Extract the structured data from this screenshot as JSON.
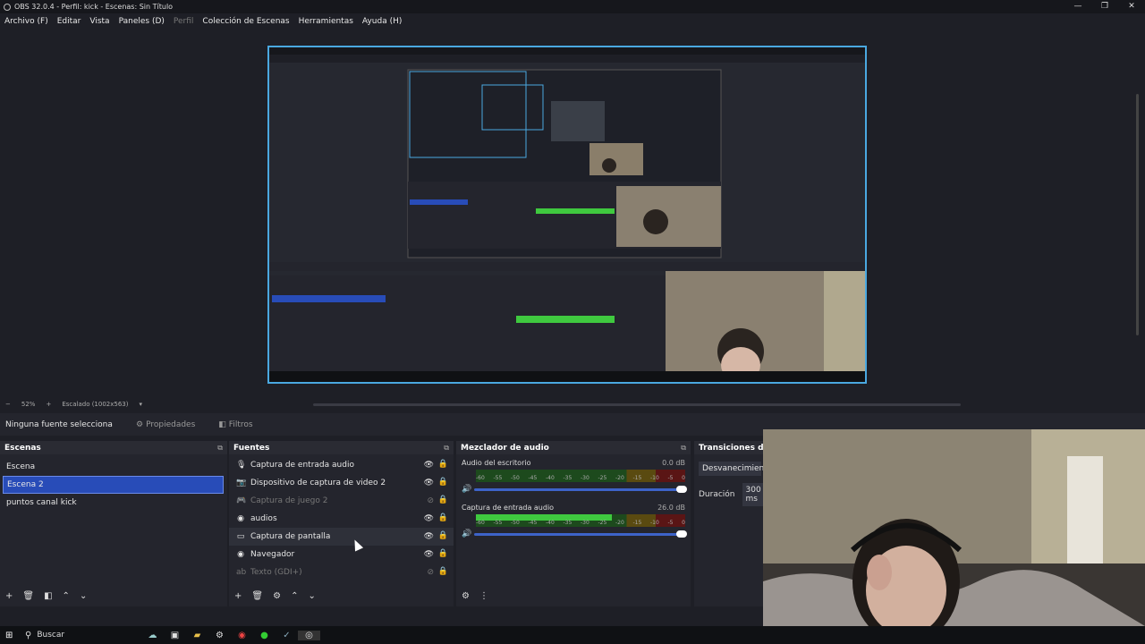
{
  "window": {
    "title": "OBS 32.0.4 - Perfil: kick - Escenas: Sin Título",
    "controls": [
      "—",
      "❐",
      "✕"
    ]
  },
  "menu": [
    {
      "label": "Archivo (F)",
      "disabled": false
    },
    {
      "label": "Editar",
      "disabled": false
    },
    {
      "label": "Vista",
      "disabled": false
    },
    {
      "label": "Paneles (D)",
      "disabled": false
    },
    {
      "label": "Perfil",
      "disabled": true
    },
    {
      "label": "Colección de Escenas",
      "disabled": false
    },
    {
      "label": "Herramientas",
      "disabled": false
    },
    {
      "label": "Ayuda (H)",
      "disabled": false
    }
  ],
  "zoom": {
    "minus": "−",
    "value": "52%",
    "plus": "+",
    "scale": "Escalado (1002x563)",
    "dropdown": "▾"
  },
  "context": {
    "no_source": "Ninguna fuente seleccionada",
    "properties": "Propiedades",
    "filters": "Filtros"
  },
  "scenes": {
    "title": "Escenas",
    "items": [
      {
        "label": "Escena",
        "selected": false
      },
      {
        "label": "Escena 2",
        "selected": true
      },
      {
        "label": "puntos canal kick",
        "selected": false
      }
    ]
  },
  "sources": {
    "title": "Fuentes",
    "items": [
      {
        "label": "Captura de entrada audio",
        "icon": "microphone-icon",
        "glyph": "🎙",
        "visible": true
      },
      {
        "label": "Dispositivo de captura de video 2",
        "icon": "camera-icon",
        "glyph": "📷",
        "visible": true
      },
      {
        "label": "Captura de juego 2",
        "icon": "gamepad-icon",
        "glyph": "🎮",
        "visible": false
      },
      {
        "label": "audios",
        "icon": "globe-icon",
        "glyph": "◉",
        "visible": true
      },
      {
        "label": "Captura de pantalla",
        "icon": "monitor-icon",
        "glyph": "▭",
        "visible": true
      },
      {
        "label": "Navegador",
        "icon": "globe-icon",
        "glyph": "◉",
        "visible": true
      },
      {
        "label": "Texto (GDI+)",
        "icon": "text-icon",
        "glyph": "ab",
        "visible": false
      }
    ]
  },
  "mixer": {
    "title": "Mezclador de audio",
    "ticks": [
      "-60",
      "-55",
      "-50",
      "-45",
      "-40",
      "-35",
      "-30",
      "-25",
      "-20",
      "-15",
      "-10",
      "-5",
      "0"
    ],
    "channels": [
      {
        "name": "Audio del escritorio",
        "db": "0.0 dB",
        "level": 0
      },
      {
        "name": "Captura de entrada audio",
        "db": "26.0 dB",
        "level": 0.65
      }
    ]
  },
  "transitions": {
    "title": "Transiciones de e",
    "type": "Desvanecimiento",
    "duration_label": "Duración",
    "duration": "300 ms"
  },
  "taskbar": {
    "search": "Buscar"
  },
  "colors": {
    "accent": "#284cb8",
    "canvas_border": "#4aa8e0",
    "meter_green": "#3fc93f"
  }
}
